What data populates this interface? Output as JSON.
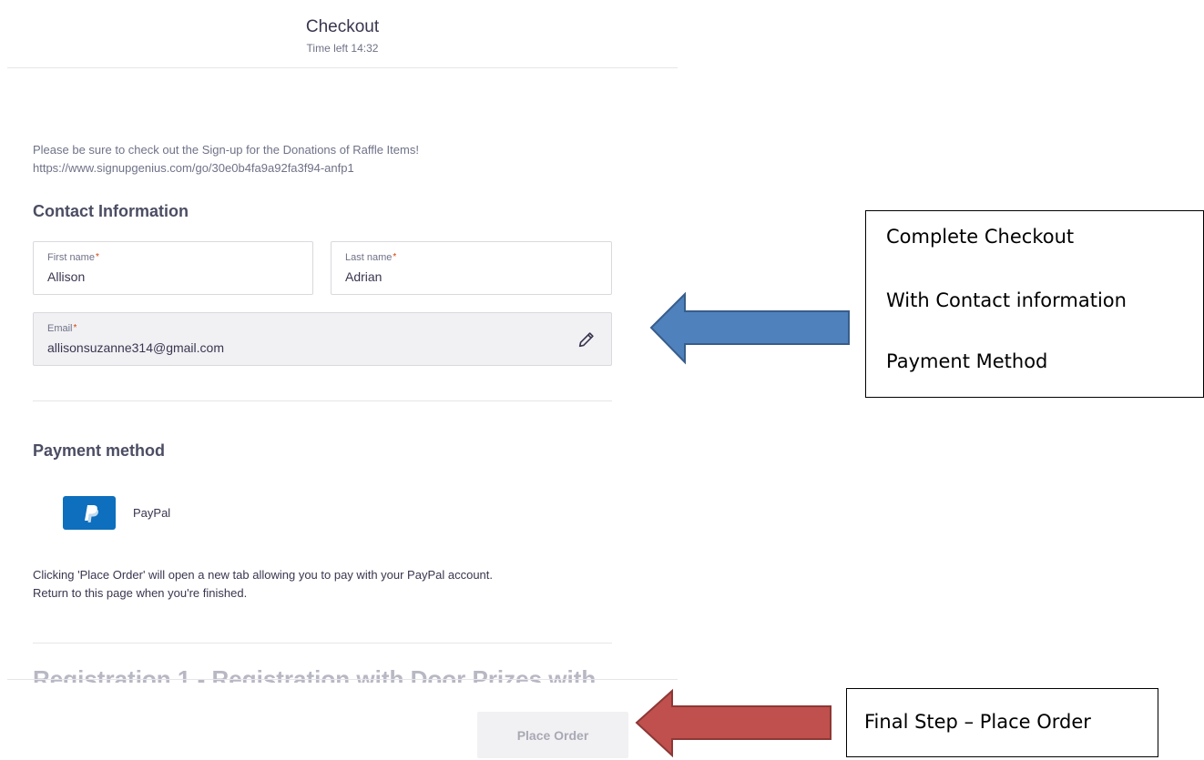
{
  "header": {
    "title": "Checkout",
    "timer": "Time left 14:32"
  },
  "notice": {
    "line1": "Please be sure to check out the Sign-up for the Donations of Raffle Items!",
    "line2": "https://www.signupgenius.com/go/30e0b4fa9a92fa3f94-anfp1"
  },
  "contact": {
    "heading": "Contact Information",
    "first_name": {
      "label": "First name",
      "value": "Allison"
    },
    "last_name": {
      "label": "Last name",
      "value": "Adrian"
    },
    "email": {
      "label": "Email",
      "value": "allisonsuzanne314@gmail.com"
    },
    "required_mark": "*"
  },
  "payment": {
    "heading": "Payment method",
    "option_label": "PayPal",
    "note_line1": "Clicking 'Place Order' will open a new tab allowing you to pay with your PayPal account.",
    "note_line2": "Return to this page when you're finished."
  },
  "registration": {
    "heading": "Registration 1 - Registration with Door Prizes with"
  },
  "footer": {
    "place_order_label": "Place Order"
  },
  "annotations": {
    "callout1": [
      "Complete Checkout",
      "With Contact information",
      "Payment Method"
    ],
    "callout2": "Final Step – Place Order"
  },
  "colors": {
    "paypal_blue": "#0d6fbd",
    "blue_arrow": "#4f81bd",
    "red_arrow": "#c0504d",
    "required": "#d1410c"
  },
  "icons": {
    "edit": "pencil-icon",
    "paypal": "paypal-logo-icon"
  }
}
